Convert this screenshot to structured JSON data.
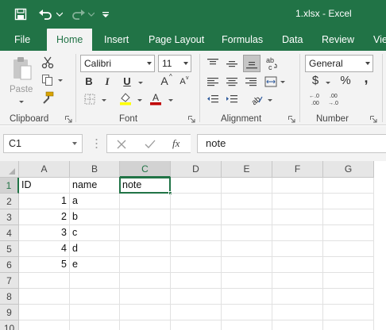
{
  "app": {
    "filename": "1.xlsx",
    "title_sep": "-",
    "app_name": "Excel",
    "title": "1.xlsx  -  Excel"
  },
  "colors": {
    "brand": "#217346",
    "ribbon_bg": "#f3f3f3",
    "font_color_bar": "#c00000",
    "highlight_bar": "#ffff00"
  },
  "quick_access": [
    "save-icon",
    "undo-icon",
    "redo-icon",
    "customize-icon"
  ],
  "tabs": [
    {
      "label": "File",
      "active": false
    },
    {
      "label": "Home",
      "active": true
    },
    {
      "label": "Insert",
      "active": false
    },
    {
      "label": "Page Layout",
      "active": false
    },
    {
      "label": "Formulas",
      "active": false
    },
    {
      "label": "Data",
      "active": false
    },
    {
      "label": "Review",
      "active": false
    },
    {
      "label": "Vie",
      "active": false
    }
  ],
  "ribbon": {
    "clipboard": {
      "label": "Clipboard",
      "paste_label": "Paste"
    },
    "font": {
      "label": "Font",
      "name": "Calibri",
      "size": "11",
      "bold": "B",
      "italic": "I",
      "underline": "U",
      "grow": "A",
      "shrink": "A"
    },
    "alignment": {
      "label": "Alignment"
    },
    "number": {
      "label": "Number",
      "format": "General",
      "currency": "$",
      "percent": "%",
      "comma": ","
    }
  },
  "formula_bar": {
    "name_box": "C1",
    "fx_label": "fx",
    "content": "note"
  },
  "sheet": {
    "columns": [
      "A",
      "B",
      "C",
      "D",
      "E",
      "F",
      "G"
    ],
    "rows": [
      "1",
      "2",
      "3",
      "4",
      "5",
      "6",
      "7",
      "8",
      "9",
      "10"
    ],
    "selected_cell": "C1",
    "data": [
      [
        "ID",
        "name",
        "note",
        "",
        "",
        "",
        ""
      ],
      [
        "1",
        "a",
        "",
        "",
        "",
        "",
        ""
      ],
      [
        "2",
        "b",
        "",
        "",
        "",
        "",
        ""
      ],
      [
        "3",
        "c",
        "",
        "",
        "",
        "",
        ""
      ],
      [
        "4",
        "d",
        "",
        "",
        "",
        "",
        ""
      ],
      [
        "5",
        "e",
        "",
        "",
        "",
        "",
        ""
      ],
      [
        "",
        "",
        "",
        "",
        "",
        "",
        ""
      ],
      [
        "",
        "",
        "",
        "",
        "",
        "",
        ""
      ],
      [
        "",
        "",
        "",
        "",
        "",
        "",
        ""
      ],
      [
        "",
        "",
        "",
        "",
        "",
        "",
        ""
      ]
    ]
  }
}
